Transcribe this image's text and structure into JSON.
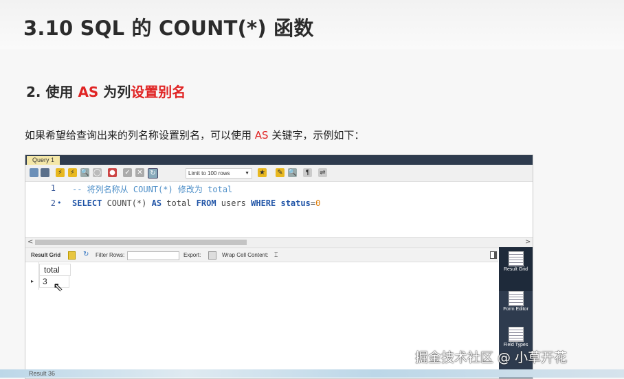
{
  "slide": {
    "title": "3.10 SQL 的 COUNT(*) 函数",
    "subtitle_parts": [
      "2. 使用 ",
      "AS",
      " 为列",
      "设置别名"
    ],
    "desc_parts": [
      "如果希望给查询出来的列名称设置别名，可以使用 ",
      "AS",
      " 关键字，示例如下："
    ]
  },
  "workbench": {
    "tab_label": "Query 1",
    "limit_label": "Limit to 100 rows",
    "editor": {
      "line_numbers": [
        "1",
        "2"
      ],
      "line2_dot": "•",
      "comment": "-- 将列名称从 COUNT(*) 修改为 total",
      "tokens": [
        "SELECT",
        " COUNT(*) ",
        "AS",
        " total ",
        "FROM",
        " users ",
        "WHERE",
        " status",
        "=",
        "0"
      ]
    },
    "scroll": {
      "left": "<",
      "right": ">"
    },
    "result_toolbar": {
      "result_grid": "Result Grid",
      "filter_rows": "Filter Rows:",
      "export": "Export:",
      "wrap": "Wrap Cell Content:"
    },
    "grid": {
      "column": "total",
      "row_indicator": "▸",
      "value": "3"
    },
    "side_panel": [
      {
        "label": "Result Grid",
        "selected": true
      },
      {
        "label": "Form Editor",
        "selected": false
      },
      {
        "label": "Field Types",
        "selected": false
      }
    ]
  },
  "bottom_tab": "Result 36",
  "watermark": "掘金技术社区 @ 小草开花",
  "colors": {
    "accent_red": "#e02424",
    "keyword_blue": "#2155a7",
    "sidebar": "#2e3b4e",
    "tab_yellow": "#f4e7a8"
  }
}
